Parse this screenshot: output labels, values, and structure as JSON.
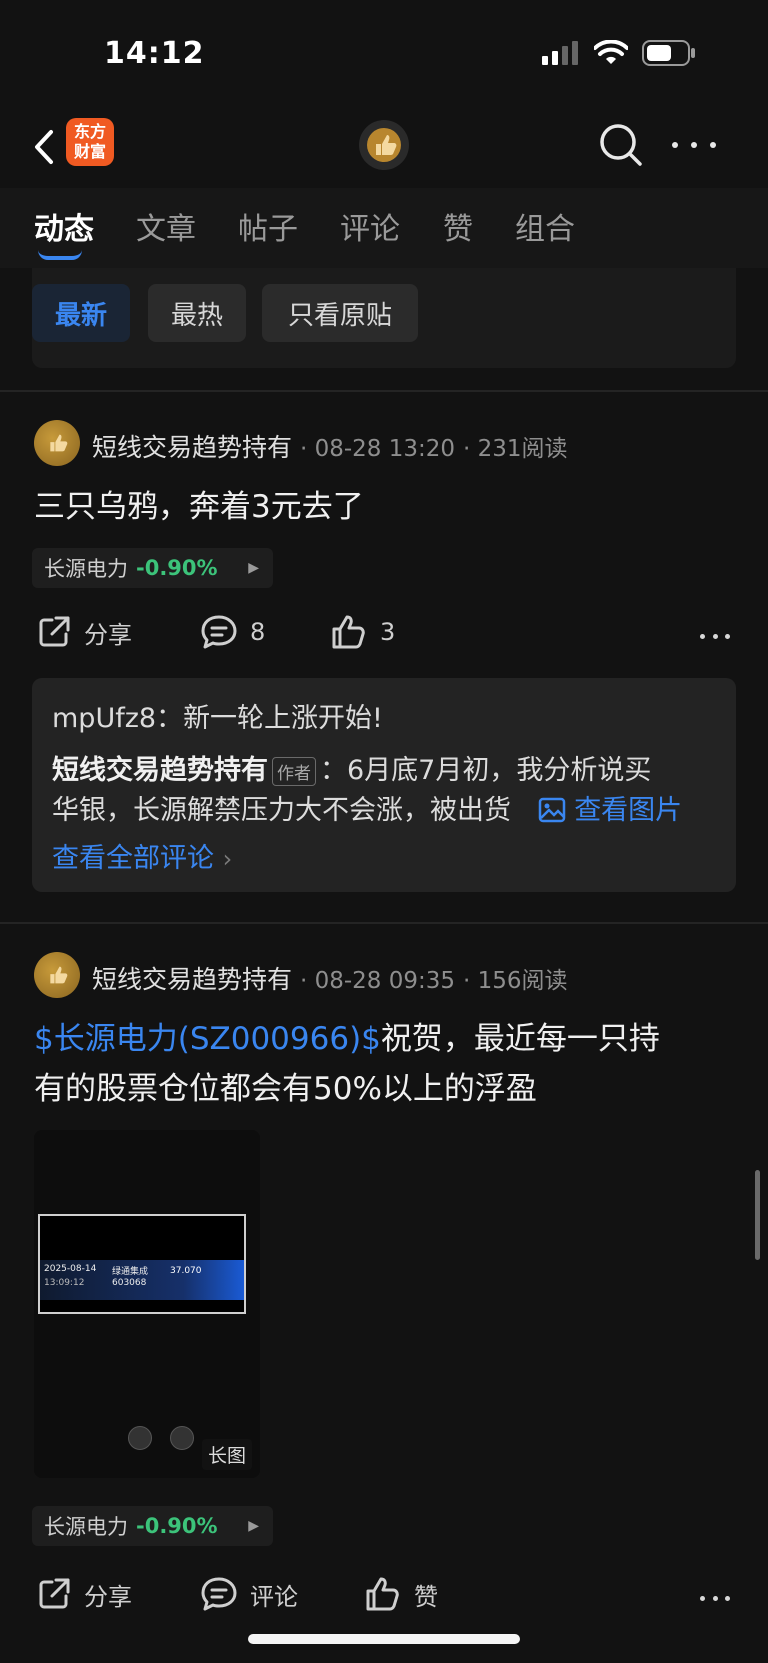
{
  "status": {
    "time": "14:12"
  },
  "nav": {
    "brand_logo": "东方\n财富",
    "icons": [
      "back-arrow-icon",
      "search-icon",
      "more-icon"
    ]
  },
  "tabs": [
    "动态",
    "文章",
    "帖子",
    "评论",
    "赞",
    "组合"
  ],
  "filters": [
    "最新",
    "最热",
    "只看原贴"
  ],
  "colors": {
    "accent": "#3a86f0",
    "positive_green": "#3cc37a",
    "background": "#121212"
  },
  "posts": [
    {
      "author": "短线交易趋势持有",
      "time": "08-28 13:20",
      "reads": "231阅读",
      "text": "三只乌鸦，奔着3元去了",
      "stock": {
        "name": "长源电力",
        "change": "-0.90%"
      },
      "actions": {
        "share": "分享",
        "comments": "8",
        "likes": "3"
      },
      "comments": [
        {
          "user": "mpUfz8：",
          "text": "新一轮上涨开始!"
        },
        {
          "user": "短线交易趋势持有",
          "tag": "作者",
          "sep": "：",
          "text1": "6月底7月初，我分析说买",
          "text2": "华银，长源解禁压力大不会涨，被出货",
          "view_img": "查看图片"
        }
      ],
      "view_all": "查看全部评论"
    },
    {
      "author": "短线交易趋势持有",
      "time": "08-28 09:35",
      "reads": "156阅读",
      "text_link": "$长源电力(SZ000966)$",
      "text_rest1": "祝贺，最近每一只持",
      "text_line2": "有的股票仓位都会有50%以上的浮盈",
      "image": {
        "badge": "长图",
        "date": "2025-08-14",
        "clock": "13:09:12",
        "stock_name": "绿通集成",
        "code": "603068",
        "price": "37.070"
      },
      "stock": {
        "name": "长源电力",
        "change": "-0.90%"
      },
      "actions": {
        "share": "分享",
        "comment": "评论",
        "like": "赞"
      }
    }
  ]
}
